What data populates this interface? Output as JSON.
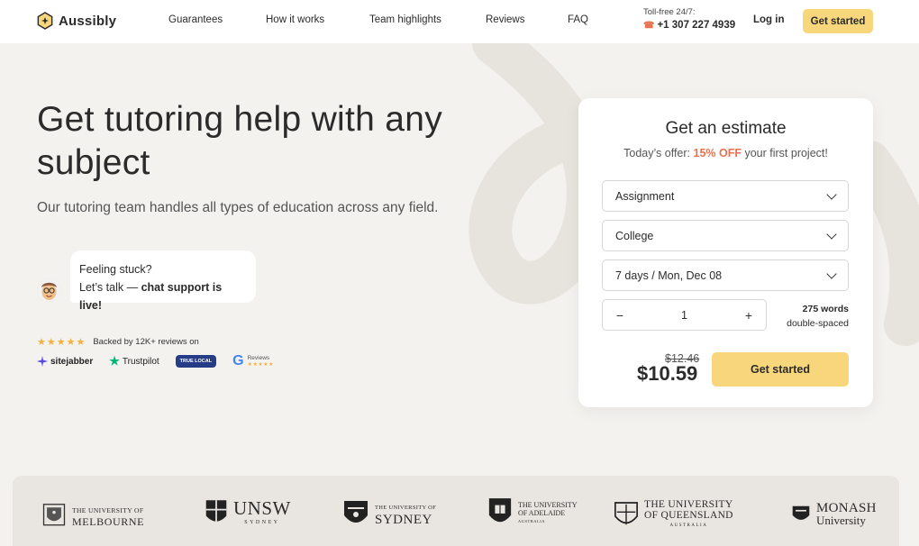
{
  "header": {
    "brand": "Aussibly",
    "nav": [
      "Guarantees",
      "How it works",
      "Team highlights",
      "Reviews",
      "FAQ"
    ],
    "phone_label": "Toll-free 24/7:",
    "phone_number": "+1 307 227 4939",
    "login_label": "Log in",
    "cta_label": "Get started"
  },
  "hero": {
    "title": "Get tutoring help with any subject",
    "subtitle": "Our tutoring team handles all types of education across any field.",
    "chat_line1": "Feeling stuck?",
    "chat_line2_prefix": "Let’s talk — ",
    "chat_line2_bold": "chat support is live!",
    "stars": "★★★★★",
    "backed_text": "Backed by 12K+ reviews on",
    "badges": {
      "sitejabber": "sitejabber",
      "trustpilot": "Trustpilot",
      "truelocal": "TRUE LOCAL",
      "google_reviews": "Reviews",
      "google_stars": "★★★★★"
    }
  },
  "estimate": {
    "title": "Get an estimate",
    "offer_prefix": "Today’s offer: ",
    "offer_highlight": "15% OFF",
    "offer_suffix": " your first project!",
    "type_value": "Assignment",
    "level_value": "College",
    "deadline_value": "7 days / Mon, Dec 08",
    "pages": "1",
    "minus": "−",
    "plus": "+",
    "words": "275 words",
    "spacing": "double-spaced",
    "old_price": "$12.46",
    "new_price": "$10.59",
    "cta_label": "Get started"
  },
  "universities": [
    {
      "line1": "THE UNIVERSITY OF",
      "line2": "MELBOURNE"
    },
    {
      "line1": "UNSW",
      "line2": "SYDNEY"
    },
    {
      "line1": "THE UNIVERSITY OF",
      "line2": "SYDNEY"
    },
    {
      "line1": "THE UNIVERSITY",
      "line2": "OF ADELAIDE",
      "line3": "AUSTRALIA"
    },
    {
      "line1": "THE UNIVERSITY",
      "line2": "OF QUEENSLAND",
      "line3": "AUSTRALIA"
    },
    {
      "line1": "MONASH",
      "line2": "University"
    }
  ],
  "colors": {
    "accent": "#f7d67c",
    "highlight": "#e8724f",
    "page_bg": "#f4f2ef",
    "strip_bg": "#e9e6e1"
  }
}
